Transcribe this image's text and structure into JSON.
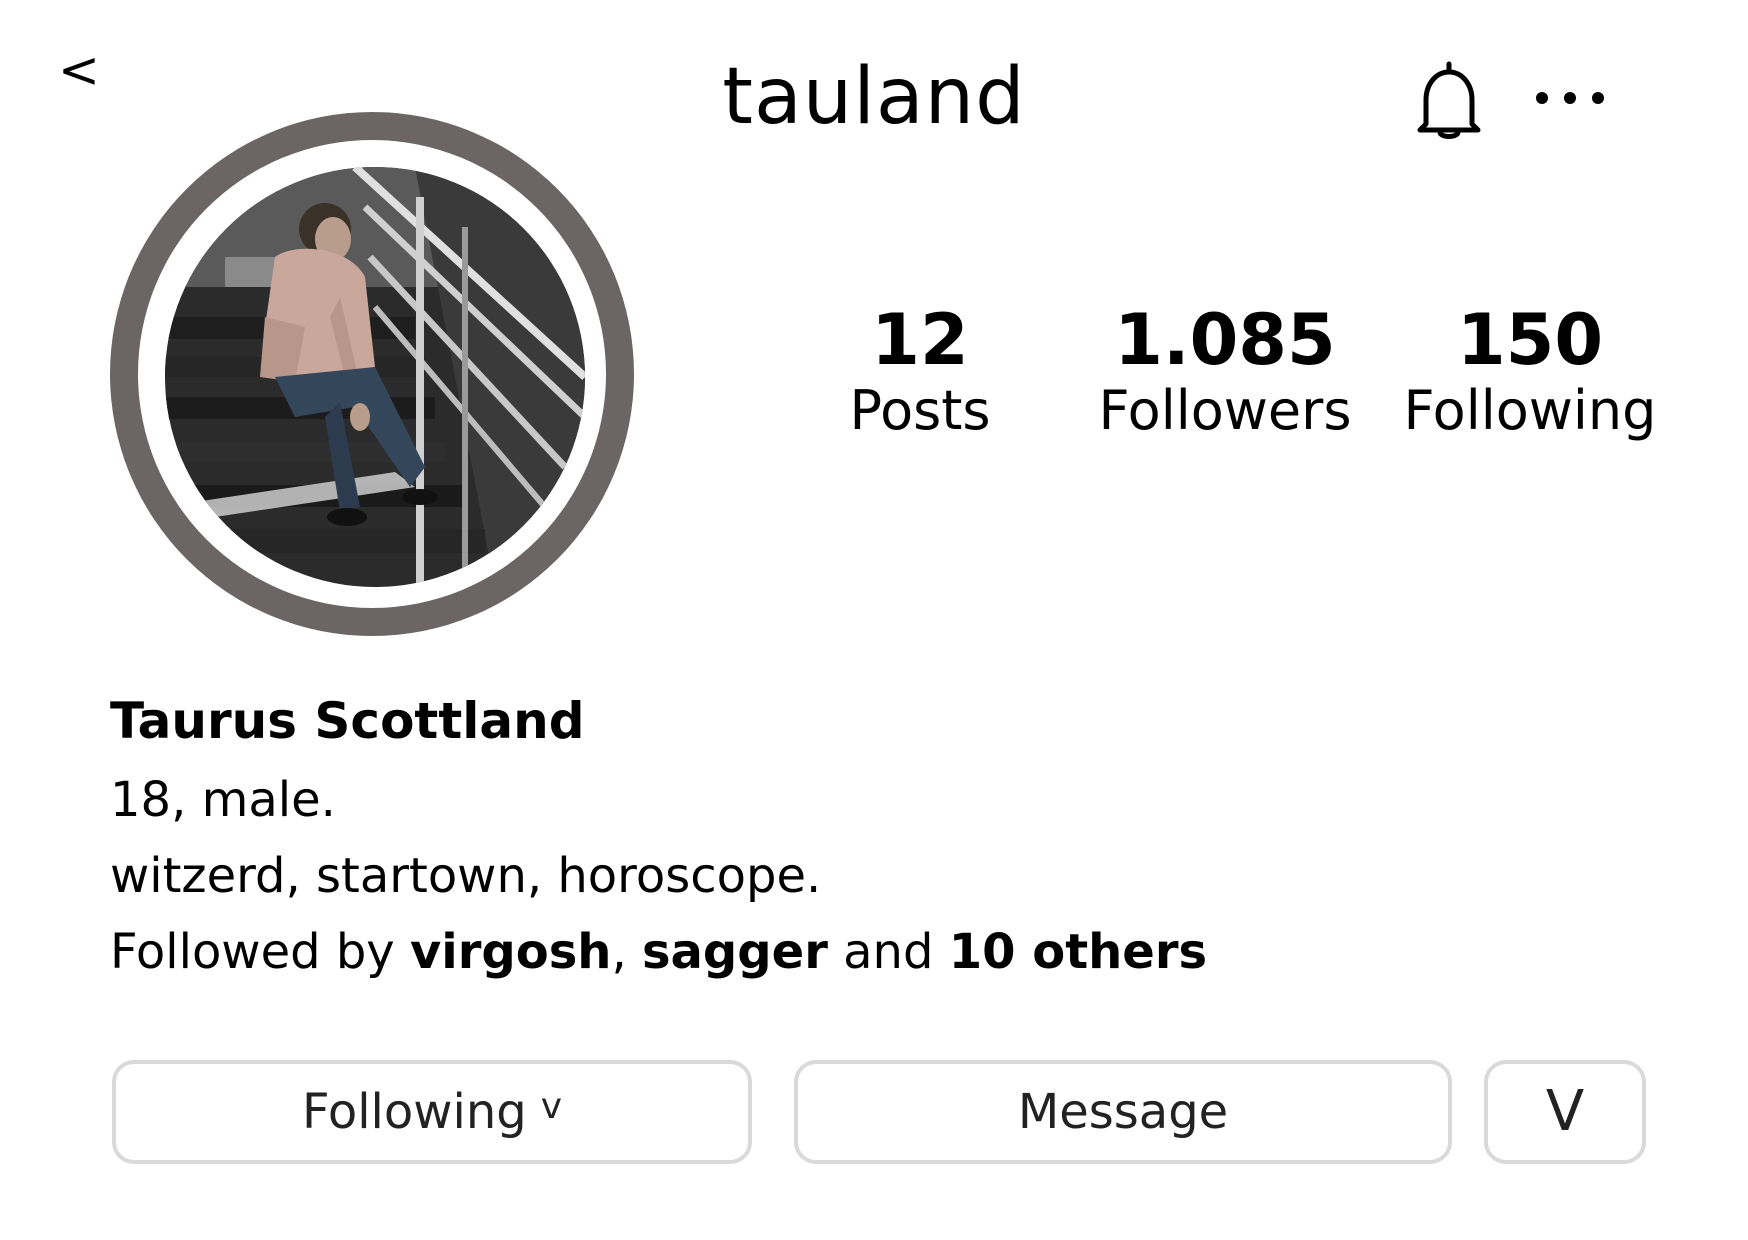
{
  "header": {
    "back_label": "<",
    "username": "tauland",
    "bell_icon": "bell-icon",
    "more_icon": "more-horizontal-icon"
  },
  "profile": {
    "avatar": "profile-photo",
    "ring_color": "#6b6665"
  },
  "stats": {
    "posts": {
      "value": "12",
      "label": "Posts"
    },
    "followers": {
      "value": "1.085",
      "label": "Followers"
    },
    "following": {
      "value": "150",
      "label": "Following"
    }
  },
  "bio": {
    "name": "Taurus Scottland",
    "line1": "18, male.",
    "line2": "witzerd, startown, horoscope.",
    "followed_prefix": "Followed by ",
    "followed_user1": "virgosh",
    "followed_sep": ", ",
    "followed_user2": "sagger",
    "followed_and": " and ",
    "followed_others": "10 others"
  },
  "actions": {
    "following_label": "Following",
    "following_chevron": "v",
    "message_label": "Message",
    "more_label": "V",
    "border_color": "#d9d9d9"
  }
}
